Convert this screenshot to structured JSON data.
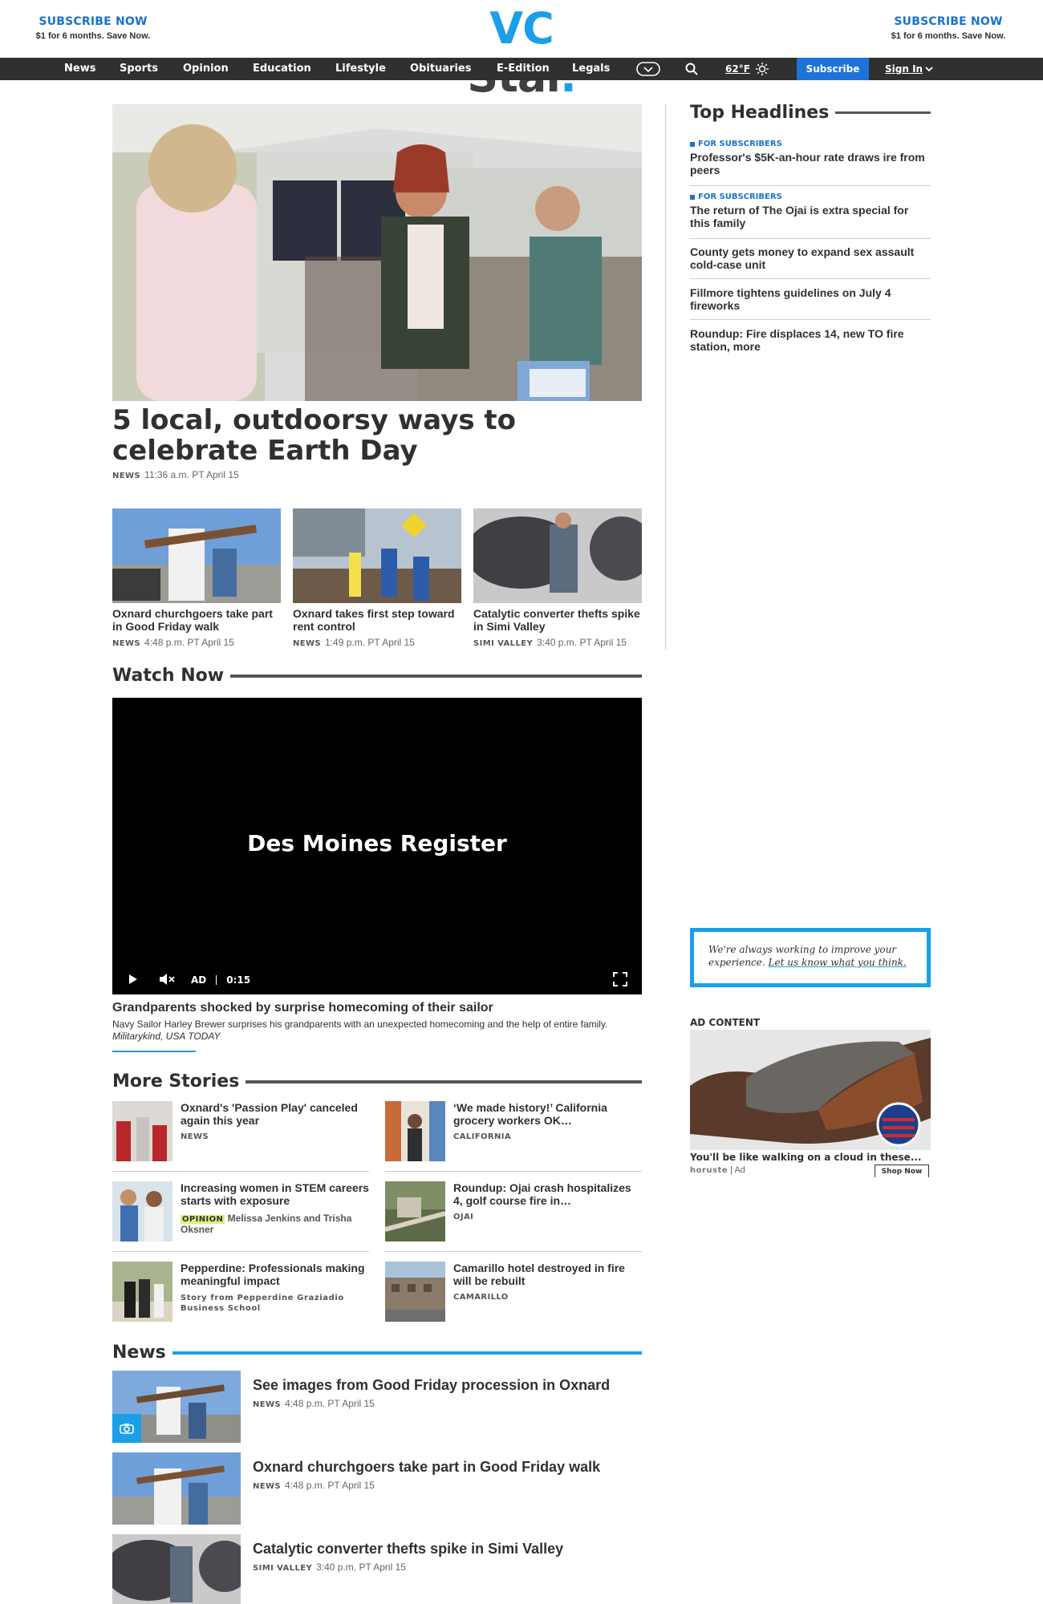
{
  "header": {
    "subscribe_left": {
      "title": "SUBSCRIBE NOW",
      "subtitle": "$1 for 6 months. Save Now."
    },
    "subscribe_right": {
      "title": "SUBSCRIBE NOW",
      "subtitle": "$1 for 6 months. Save Now."
    },
    "logo": {
      "vc": "VC",
      "star": "Star",
      "dot": "."
    },
    "brand_color": "#1a9fe8"
  },
  "nav": {
    "items": [
      "News",
      "Sports",
      "Opinion",
      "Education",
      "Lifestyle",
      "Obituaries",
      "E-Edition",
      "Legals"
    ],
    "weather": "62°F",
    "subscribe": "Subscribe",
    "signin": "Sign In",
    "icons": [
      "usa-today-network-icon",
      "search-icon",
      "sun-icon",
      "chevron-down-icon"
    ]
  },
  "hero": {
    "title": "5 local, outdoorsy ways to celebrate Earth Day",
    "section": "NEWS",
    "time": "11:36 a.m. PT April 15"
  },
  "cards": [
    {
      "title": "Oxnard churchgoers take part in Good Friday walk",
      "section": "NEWS",
      "time": "4:48 p.m. PT April 15"
    },
    {
      "title": "Oxnard takes first step toward rent control",
      "section": "NEWS",
      "time": "1:49 p.m. PT April 15"
    },
    {
      "title": "Catalytic converter thefts spike in Simi Valley",
      "section": "SIMI VALLEY",
      "time": "3:40 p.m. PT April 15"
    }
  ],
  "watch_now": {
    "label": "Watch Now",
    "brand": "Des Moines Register",
    "ad": "AD",
    "time": "0:15",
    "title": "Grandparents shocked by surprise homecoming of their sailor",
    "description": "Navy Sailor Harley Brewer surprises his grandparents with an unexpected homecoming and the help of entire family.",
    "credit": "Militarykind, USA TODAY"
  },
  "more_stories": {
    "label": "More Stories",
    "items": [
      {
        "title": "Oxnard's 'Passion Play' canceled again this year",
        "section": "NEWS"
      },
      {
        "title": "‘We made history!’ California grocery workers OK…",
        "section": "CALIFORNIA"
      },
      {
        "title": "Increasing women in STEM careers starts with exposure",
        "section": "OPINION",
        "byline": "Melissa Jenkins and Trisha Oksner"
      },
      {
        "title": "Roundup: Ojai crash hospitalizes 4, golf course fire in…",
        "section": "OJAI"
      },
      {
        "title": "Pepperdine: Professionals making meaningful impact",
        "section": "Story from Pepperdine Graziadio Business School"
      },
      {
        "title": "Camarillo hotel destroyed in fire will be rebuilt",
        "section": "CAMARILLO"
      }
    ]
  },
  "news": {
    "label": "News",
    "accent": "#1a9fe8",
    "items": [
      {
        "title": "See images from Good Friday procession in Oxnard",
        "section": "NEWS",
        "time": "4:48 p.m. PT April 15"
      },
      {
        "title": "Oxnard churchgoers take part in Good Friday walk",
        "section": "NEWS",
        "time": "4:48 p.m. PT April 15"
      },
      {
        "title": "Catalytic converter thefts spike in Simi Valley",
        "section": "SIMI VALLEY",
        "time": "3:40 p.m. PT April 15"
      }
    ]
  },
  "top_headlines": {
    "label": "Top Headlines",
    "items": [
      {
        "flag": "FOR SUBSCRIBERS",
        "title": "Professor's $5K-an-hour rate draws ire from peers"
      },
      {
        "flag": "FOR SUBSCRIBERS",
        "title": "The return of The Ojai is extra special for this family"
      },
      {
        "flag": "",
        "title": "County gets money to expand sex assault cold-case unit"
      },
      {
        "flag": "",
        "title": "Fillmore tightens guidelines on July 4 fireworks"
      },
      {
        "flag": "",
        "title": "Roundup: Fire displaces 14, new TO fire station, more"
      }
    ]
  },
  "feedback": {
    "text": "We're always working to improve your experience.",
    "link": "Let us know what you think."
  },
  "ad": {
    "label": "AD CONTENT",
    "caption": "You'll be like walking on a cloud in these...",
    "source": "horuste",
    "tag": "Ad",
    "button": "Shop Now"
  }
}
